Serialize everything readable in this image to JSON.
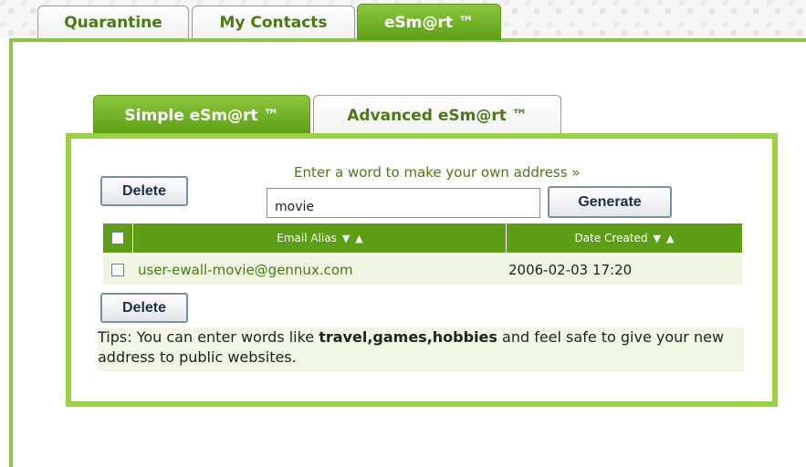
{
  "main_tabs": [
    {
      "label": "Quarantine",
      "active": false
    },
    {
      "label": "My Contacts",
      "active": false
    },
    {
      "label": "eSm@rt ™",
      "active": true
    }
  ],
  "sub_tabs": [
    {
      "label": "Simple eSm@rt ™",
      "active": true
    },
    {
      "label": "Advanced eSm@rt ™",
      "active": false
    }
  ],
  "form": {
    "hint": "Enter a word to make your own address »",
    "input_value": "movie",
    "generate_label": "Generate"
  },
  "delete_label": "Delete",
  "table": {
    "columns": [
      "Email Alias",
      "Date Created"
    ],
    "rows": [
      {
        "email": "user-ewall-movie@gennux.com",
        "date": "2006-02-03 17:20",
        "checked": false
      }
    ]
  },
  "tips": {
    "prefix": "Tips: You can enter words like ",
    "keywords": "travel,games,hobbies",
    "suffix": " and feel safe to give your new address to public websites."
  },
  "colors": {
    "accent_green": "#8cc63f",
    "dark_green": "#5c9e14",
    "text_green": "#4a7a12",
    "row_bg": "#eef6e2"
  }
}
